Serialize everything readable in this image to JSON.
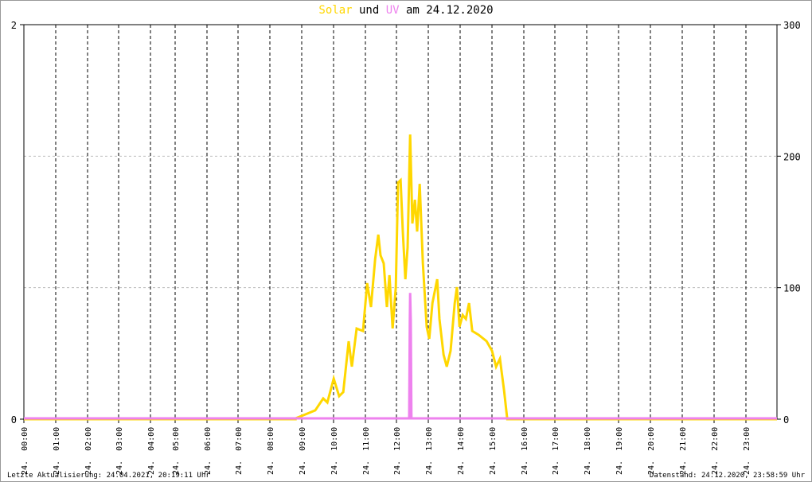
{
  "title": {
    "part1": "Solar",
    "part2": " und ",
    "part3": "UV",
    "part4": " am 24.12.2020"
  },
  "colors": {
    "solar": "#ffd700",
    "uv": "#ee82ee",
    "grid": "#000000",
    "hgrid": "#bbbbbb"
  },
  "footer": {
    "left": "Letzte Aktualisierung: 24.04.2021, 20:19:11 Uhr",
    "right": "Datenstand: 24.12.2020, 23:58:59 Uhr"
  },
  "chart_data": {
    "type": "line",
    "title": "Solar und UV am 24.12.2020",
    "x_tick_labels": [
      "24. 00:00",
      "24. 01:00",
      "24. 02:00",
      "24. 03:00",
      "24. 04:00",
      "24. 05:00",
      "24. 06:00",
      "24. 07:00",
      "24. 08:00",
      "24. 09:00",
      "24. 10:00",
      "24. 11:00",
      "24. 12:00",
      "24. 13:00",
      "24. 14:00",
      "24. 15:00",
      "24. 16:00",
      "24. 17:00",
      "24. 18:00",
      "24. 19:00",
      "24. 20:00",
      "24. 21:00",
      "24. 22:00",
      "24. 23:00"
    ],
    "y_left": {
      "label": "UV",
      "range": [
        0,
        2
      ],
      "ticks": [
        "0",
        "2"
      ]
    },
    "y_right": {
      "label": "Solar",
      "range": [
        0,
        300
      ],
      "ticks": [
        "0",
        "100",
        "200",
        "300"
      ]
    },
    "grid": true,
    "series": [
      {
        "name": "Solar",
        "axis": "right",
        "points": [
          [
            8.83,
            0.6
          ],
          [
            9.08,
            3
          ],
          [
            9.45,
            6.7
          ],
          [
            9.7,
            15.7
          ],
          [
            9.83,
            12.7
          ],
          [
            10.03,
            30.8
          ],
          [
            10.2,
            17.5
          ],
          [
            10.33,
            20.6
          ],
          [
            10.5,
            59.3
          ],
          [
            10.6,
            39.9
          ],
          [
            10.75,
            68.9
          ],
          [
            10.95,
            67.1
          ],
          [
            11.08,
            103.4
          ],
          [
            11.2,
            85.3
          ],
          [
            11.33,
            121.5
          ],
          [
            11.43,
            140.3
          ],
          [
            11.5,
            124.6
          ],
          [
            11.6,
            118.5
          ],
          [
            11.7,
            85.3
          ],
          [
            11.78,
            109.5
          ],
          [
            11.88,
            69
          ],
          [
            11.98,
            100.4
          ],
          [
            12.05,
            179.9
          ],
          [
            12.13,
            181.7
          ],
          [
            12.2,
            142.7
          ],
          [
            12.28,
            106.4
          ],
          [
            12.35,
            130.6
          ],
          [
            12.43,
            216.5
          ],
          [
            12.5,
            148.8
          ],
          [
            12.58,
            166.9
          ],
          [
            12.65,
            142.7
          ],
          [
            12.73,
            178.9
          ],
          [
            12.83,
            118.5
          ],
          [
            12.95,
            70.2
          ],
          [
            13.03,
            61.1
          ],
          [
            13.13,
            88.3
          ],
          [
            13.28,
            106.4
          ],
          [
            13.35,
            76.2
          ],
          [
            13.48,
            49
          ],
          [
            13.58,
            39.9
          ],
          [
            13.7,
            52
          ],
          [
            13.83,
            88.3
          ],
          [
            13.9,
            100.4
          ],
          [
            13.98,
            70.2
          ],
          [
            14.08,
            79.2
          ],
          [
            14.18,
            76.2
          ],
          [
            14.28,
            88.3
          ],
          [
            14.38,
            67.1
          ],
          [
            14.58,
            64.1
          ],
          [
            14.83,
            59.3
          ],
          [
            15.0,
            52
          ],
          [
            15.13,
            39.9
          ],
          [
            15.25,
            45.9
          ],
          [
            15.38,
            21.8
          ],
          [
            15.48,
            0
          ]
        ]
      },
      {
        "name": "UV",
        "axis": "left",
        "points": [
          [
            12.4,
            0
          ],
          [
            12.42,
            0.5
          ],
          [
            12.43,
            0.64
          ],
          [
            12.45,
            0.5
          ],
          [
            12.47,
            0
          ]
        ]
      }
    ]
  }
}
